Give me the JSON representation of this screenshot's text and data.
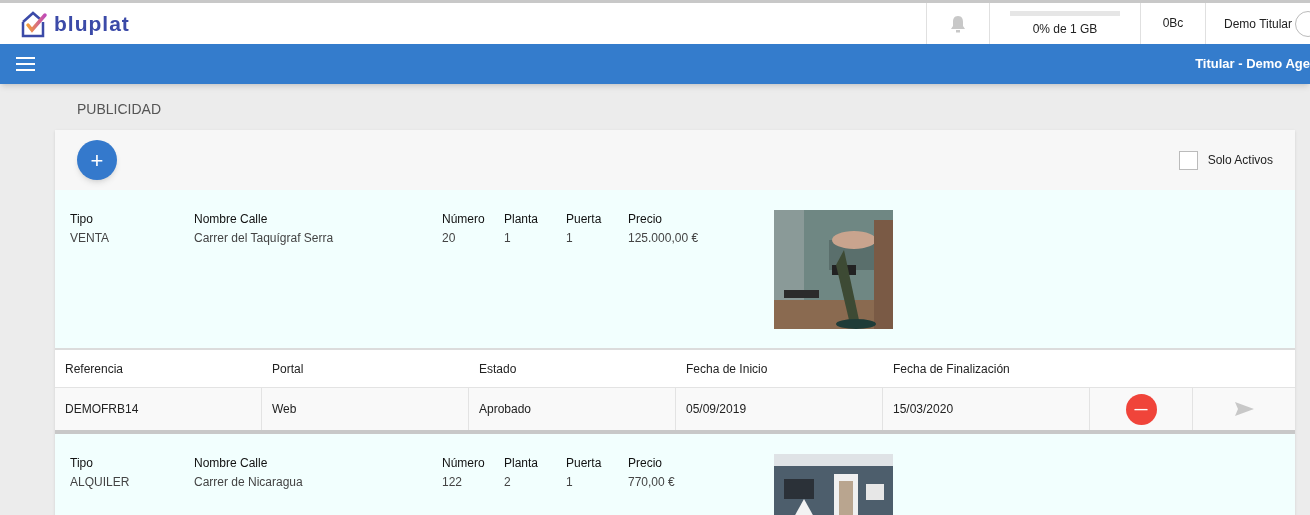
{
  "header": {
    "logo_text": "bluplat",
    "storage": {
      "level": 0,
      "label": "0% de 1 GB"
    },
    "usage": "0Bc",
    "user": "Demo Titular"
  },
  "navbar": {
    "subtitle": "Titular - Demo Age"
  },
  "page_title": "PUBLICIDAD",
  "toolbar": {
    "add_label": "+",
    "filter": {
      "label": "Solo Activos",
      "checked": false
    }
  },
  "listings": [
    {
      "fields": [
        {
          "label": "Tipo",
          "value": "VENTA"
        },
        {
          "label": "Nombre Calle",
          "value": "Carrer del Taquígraf Serra"
        },
        {
          "label": "Número",
          "value": "20"
        },
        {
          "label": "Planta",
          "value": "1"
        },
        {
          "label": "Puerta",
          "value": "1"
        },
        {
          "label": "Precio",
          "value": "125.000,00 €"
        }
      ],
      "campaigns": {
        "columns": [
          "Referencia",
          "Portal",
          "Estado",
          "Fecha de Inicio",
          "Fecha de Finalización"
        ],
        "rows": [
          {
            "cells": [
              "DEMOFRB14",
              "Web",
              "Aprobado",
              "05/09/2019",
              "15/03/2020"
            ],
            "remove_label": "—"
          }
        ]
      }
    },
    {
      "fields": [
        {
          "label": "Tipo",
          "value": "ALQUILER"
        },
        {
          "label": "Nombre Calle",
          "value": "Carrer de Nicaragua"
        },
        {
          "label": "Número",
          "value": "122"
        },
        {
          "label": "Planta",
          "value": "2"
        },
        {
          "label": "Puerta",
          "value": "1"
        },
        {
          "label": "Precio",
          "value": "770,00 €"
        }
      ]
    }
  ]
}
